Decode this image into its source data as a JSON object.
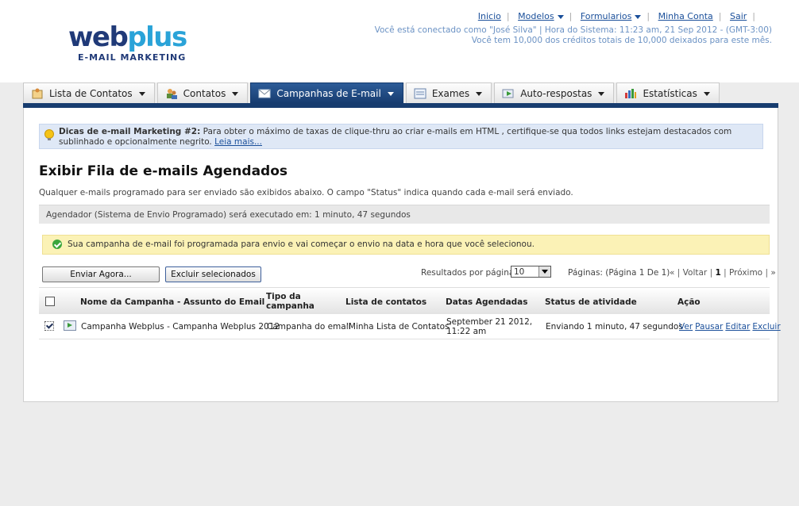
{
  "logo": {
    "main_web": "web",
    "main_plus": "plus",
    "sub": "E-MAIL MARKETING"
  },
  "topnav": {
    "inicio": "Inicio",
    "modelos": "Modelos",
    "formularios": "Formularios",
    "minha_conta": "Minha Conta",
    "sair": "Sair"
  },
  "status": {
    "line1": "Você está conectado como \"José Silva\" | Hora do Sistema: 11:23 am, 21 Sep 2012 - (GMT-3:00)",
    "line2": "Você tem 10,000 dos créditos totais de 10,000 deixados para este mês."
  },
  "tabs": [
    {
      "label": "Lista de Contatos",
      "icon": "contact-list-icon",
      "active": false
    },
    {
      "label": "Contatos",
      "icon": "contacts-icon",
      "active": false
    },
    {
      "label": "Campanhas de E-mail",
      "icon": "envelope-icon",
      "active": true
    },
    {
      "label": "Exames",
      "icon": "form-icon",
      "active": false
    },
    {
      "label": "Auto-respostas",
      "icon": "autoresponder-icon",
      "active": false
    },
    {
      "label": "Estatísticas",
      "icon": "bar-chart-icon",
      "active": false
    }
  ],
  "tip": {
    "bold": "Dicas de e-mail Marketing #2:",
    "text": " Para obter o máximo de taxas de clique-thru ao criar e-mails em HTML , certifique-se qua todos links estejam destacados com sublinhado e opcionalmente negrito. ",
    "link": "Leia mais..."
  },
  "page": {
    "title": "Exibir Fila de e-mails Agendados",
    "description": "Qualquer e-mails programado para ser enviado são exibidos abaixo. O campo \"Status\" indica quando cada e-mail será enviado.",
    "scheduler": "Agendador (Sistema de Envio Programado) será executado em: 1 minuto, 47 segundos",
    "success": "Sua campanha de e-mail foi programada para envio e vai começar o envio na data e hora que você selecionou."
  },
  "toolbar": {
    "send_now": "Enviar Agora...",
    "delete_selected": "Excluir selecionados",
    "per_page_label": "Resultados por página:",
    "per_page_value": "10",
    "pages_label": "Páginas: (Página 1 De 1)",
    "pager_first": "«",
    "pager_prev": "Voltar",
    "pager_current": "1",
    "pager_next": "Próximo",
    "pager_last": "»"
  },
  "table": {
    "headers": {
      "name": "Nome da Campanha - Assunto do Email",
      "type": "Tipo da campanha",
      "lists": "Lista de contatos",
      "dates": "Datas Agendadas",
      "status": "Status de atividade",
      "action": "Ação"
    },
    "rows": [
      {
        "checked": true,
        "name": "Campanha Webplus - Campanha Webplus 2012",
        "type": "Campanha do email",
        "lists": "'Minha Lista de Contatos'",
        "date": "September 21 2012, 11:22 am",
        "status": "Enviando 1 minuto, 47 segundos",
        "actions": {
          "view": "Ver",
          "pause": "Pausar",
          "edit": "Editar",
          "delete": "Excluir"
        }
      }
    ]
  }
}
